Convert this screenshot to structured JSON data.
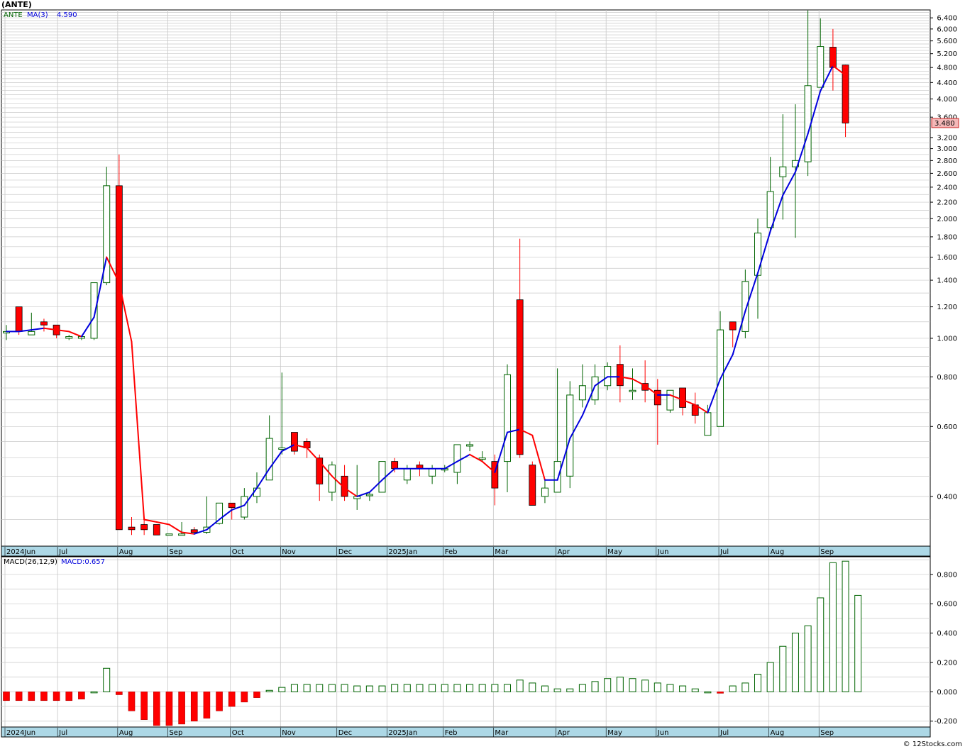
{
  "header": {
    "symbol_title": "(ANTE)"
  },
  "legend": {
    "ticker": "ANTE",
    "ma_label": "MA(3)",
    "ma_value": "4.590",
    "macd_label": "MACD(26,12,9)",
    "macd_value": "MACD:0.657"
  },
  "watermark": "© 12Stocks.com",
  "colors": {
    "up": "#006400",
    "down": "#ff0000",
    "ma_rising": "#0000dd",
    "ma_falling": "#ff0000",
    "axis_band": "#add8e6",
    "grid": "#c8c8c8",
    "last_price_box": "#f4b8b8"
  },
  "chart_data": [
    {
      "type": "candlestick",
      "scale": "log",
      "ylim": [
        0.3,
        6.7
      ],
      "yticks": [
        "6.400",
        "6.000",
        "5.600",
        "5.200",
        "4.800",
        "4.400",
        "4.000",
        "3.600",
        "3.200",
        "3.000",
        "2.800",
        "2.600",
        "2.400",
        "2.200",
        "2.000",
        "1.800",
        "1.600",
        "1.400",
        "1.200",
        "1.000",
        "0.800",
        "0.600",
        "0.400"
      ],
      "last_price": "3.480",
      "x_months": [
        "2024Jun",
        "Jul",
        "Aug",
        "Sep",
        "Oct",
        "Nov",
        "Dec",
        "2025Jan",
        "Feb",
        "Mar",
        "Apr",
        "May",
        "Jun",
        "Jul",
        "Aug",
        "Sep"
      ],
      "bars": [
        {
          "o": 1.04,
          "h": 1.08,
          "l": 0.99,
          "c": 1.04
        },
        {
          "o": 1.2,
          "h": 1.2,
          "l": 1.02,
          "c": 1.04
        },
        {
          "o": 1.02,
          "h": 1.16,
          "l": 1.02,
          "c": 1.04
        },
        {
          "o": 1.1,
          "h": 1.12,
          "l": 1.04,
          "c": 1.08
        },
        {
          "o": 1.08,
          "h": 1.08,
          "l": 1.0,
          "c": 1.02
        },
        {
          "o": 1.0,
          "h": 1.02,
          "l": 0.99,
          "c": 1.01
        },
        {
          "o": 1.0,
          "h": 1.01,
          "l": 0.99,
          "c": 1.01
        },
        {
          "o": 1.0,
          "h": 1.38,
          "l": 0.99,
          "c": 1.38
        },
        {
          "o": 1.38,
          "h": 2.7,
          "l": 1.36,
          "c": 2.42
        },
        {
          "o": 2.42,
          "h": 2.9,
          "l": 0.33,
          "c": 0.33
        },
        {
          "o": 0.335,
          "h": 0.355,
          "l": 0.32,
          "c": 0.33
        },
        {
          "o": 0.34,
          "h": 0.355,
          "l": 0.32,
          "c": 0.33
        },
        {
          "o": 0.34,
          "h": 0.34,
          "l": 0.32,
          "c": 0.32
        },
        {
          "o": 0.322,
          "h": 0.322,
          "l": 0.32,
          "c": 0.322
        },
        {
          "o": 0.321,
          "h": 0.345,
          "l": 0.32,
          "c": 0.322
        },
        {
          "o": 0.33,
          "h": 0.335,
          "l": 0.322,
          "c": 0.325
        },
        {
          "o": 0.325,
          "h": 0.4,
          "l": 0.322,
          "c": 0.335
        },
        {
          "o": 0.342,
          "h": 0.385,
          "l": 0.34,
          "c": 0.385
        },
        {
          "o": 0.385,
          "h": 0.385,
          "l": 0.35,
          "c": 0.375
        },
        {
          "o": 0.355,
          "h": 0.42,
          "l": 0.35,
          "c": 0.4
        },
        {
          "o": 0.4,
          "h": 0.46,
          "l": 0.385,
          "c": 0.42
        },
        {
          "o": 0.44,
          "h": 0.64,
          "l": 0.44,
          "c": 0.56
        },
        {
          "o": 0.53,
          "h": 0.82,
          "l": 0.51,
          "c": 0.53
        },
        {
          "o": 0.58,
          "h": 0.58,
          "l": 0.51,
          "c": 0.52
        },
        {
          "o": 0.55,
          "h": 0.56,
          "l": 0.5,
          "c": 0.53
        },
        {
          "o": 0.5,
          "h": 0.51,
          "l": 0.39,
          "c": 0.43
        },
        {
          "o": 0.41,
          "h": 0.49,
          "l": 0.39,
          "c": 0.48
        },
        {
          "o": 0.45,
          "h": 0.48,
          "l": 0.39,
          "c": 0.4
        },
        {
          "o": 0.395,
          "h": 0.48,
          "l": 0.37,
          "c": 0.4
        },
        {
          "o": 0.405,
          "h": 0.41,
          "l": 0.39,
          "c": 0.405
        },
        {
          "o": 0.41,
          "h": 0.49,
          "l": 0.41,
          "c": 0.49
        },
        {
          "o": 0.49,
          "h": 0.5,
          "l": 0.46,
          "c": 0.47
        },
        {
          "o": 0.44,
          "h": 0.48,
          "l": 0.43,
          "c": 0.47
        },
        {
          "o": 0.48,
          "h": 0.49,
          "l": 0.45,
          "c": 0.47
        },
        {
          "o": 0.45,
          "h": 0.48,
          "l": 0.43,
          "c": 0.47
        },
        {
          "o": 0.47,
          "h": 0.48,
          "l": 0.46,
          "c": 0.47
        },
        {
          "o": 0.46,
          "h": 0.54,
          "l": 0.43,
          "c": 0.54
        },
        {
          "o": 0.54,
          "h": 0.55,
          "l": 0.52,
          "c": 0.54
        },
        {
          "o": 0.5,
          "h": 0.52,
          "l": 0.49,
          "c": 0.5
        },
        {
          "o": 0.49,
          "h": 0.51,
          "l": 0.38,
          "c": 0.42
        },
        {
          "o": 0.49,
          "h": 0.86,
          "l": 0.41,
          "c": 0.81
        },
        {
          "o": 1.25,
          "h": 1.78,
          "l": 0.5,
          "c": 0.51
        },
        {
          "o": 0.48,
          "h": 0.49,
          "l": 0.38,
          "c": 0.38
        },
        {
          "o": 0.4,
          "h": 0.44,
          "l": 0.385,
          "c": 0.42
        },
        {
          "o": 0.41,
          "h": 0.84,
          "l": 0.41,
          "c": 0.49
        },
        {
          "o": 0.45,
          "h": 0.78,
          "l": 0.42,
          "c": 0.72
        },
        {
          "o": 0.7,
          "h": 0.86,
          "l": 0.67,
          "c": 0.76
        },
        {
          "o": 0.7,
          "h": 0.86,
          "l": 0.68,
          "c": 0.8
        },
        {
          "o": 0.76,
          "h": 0.87,
          "l": 0.74,
          "c": 0.85
        },
        {
          "o": 0.86,
          "h": 0.96,
          "l": 0.69,
          "c": 0.76
        },
        {
          "o": 0.74,
          "h": 0.84,
          "l": 0.7,
          "c": 0.74
        },
        {
          "o": 0.77,
          "h": 0.88,
          "l": 0.69,
          "c": 0.74
        },
        {
          "o": 0.74,
          "h": 0.79,
          "l": 0.54,
          "c": 0.68
        },
        {
          "o": 0.66,
          "h": 0.74,
          "l": 0.65,
          "c": 0.74
        },
        {
          "o": 0.75,
          "h": 0.75,
          "l": 0.64,
          "c": 0.67
        },
        {
          "o": 0.68,
          "h": 0.73,
          "l": 0.61,
          "c": 0.64
        },
        {
          "o": 0.57,
          "h": 0.68,
          "l": 0.57,
          "c": 0.65
        },
        {
          "o": 0.6,
          "h": 1.17,
          "l": 0.6,
          "c": 1.05
        },
        {
          "o": 1.1,
          "h": 1.1,
          "l": 0.95,
          "c": 1.05
        },
        {
          "o": 1.04,
          "h": 1.49,
          "l": 1.0,
          "c": 1.39
        },
        {
          "o": 1.44,
          "h": 2.0,
          "l": 1.12,
          "c": 1.84
        },
        {
          "o": 1.9,
          "h": 2.86,
          "l": 1.85,
          "c": 2.34
        },
        {
          "o": 2.55,
          "h": 3.66,
          "l": 1.99,
          "c": 2.7
        },
        {
          "o": 2.7,
          "h": 3.88,
          "l": 1.79,
          "c": 2.8
        },
        {
          "o": 2.78,
          "h": 6.68,
          "l": 2.56,
          "c": 4.32
        },
        {
          "o": 4.28,
          "h": 6.38,
          "l": 4.28,
          "c": 5.42
        },
        {
          "o": 5.4,
          "h": 6.0,
          "l": 4.2,
          "c": 4.8
        },
        {
          "o": 4.87,
          "h": 4.88,
          "l": 3.21,
          "c": 3.48
        }
      ],
      "ma": [
        1.04,
        1.04,
        1.05,
        1.06,
        1.05,
        1.04,
        1.01,
        1.13,
        1.6,
        1.38,
        0.98,
        0.35,
        0.345,
        0.34,
        0.325,
        0.322,
        0.33,
        0.35,
        0.37,
        0.38,
        0.42,
        0.47,
        0.52,
        0.54,
        0.53,
        0.49,
        0.45,
        0.42,
        0.4,
        0.41,
        0.44,
        0.47,
        0.47,
        0.47,
        0.47,
        0.47,
        0.49,
        0.51,
        0.49,
        0.46,
        0.58,
        0.59,
        0.57,
        0.44,
        0.44,
        0.56,
        0.64,
        0.76,
        0.8,
        0.8,
        0.79,
        0.76,
        0.72,
        0.72,
        0.7,
        0.68,
        0.65,
        0.79,
        0.91,
        1.17,
        1.46,
        1.86,
        2.29,
        2.62,
        3.27,
        4.19,
        4.85,
        4.59
      ]
    },
    {
      "type": "bar",
      "title": "MACD(26,12,9)",
      "ylim": [
        -0.24,
        0.92
      ],
      "yticks": [
        "0.800",
        "0.600",
        "0.400",
        "0.200",
        "0.000",
        "-0.200"
      ],
      "x_months": [
        "2024Jun",
        "Jul",
        "Aug",
        "Sep",
        "Oct",
        "Nov",
        "Dec",
        "2025Jan",
        "Feb",
        "Mar",
        "Apr",
        "May",
        "Jun",
        "Jul",
        "Aug",
        "Sep"
      ],
      "values": [
        -0.06,
        -0.06,
        -0.06,
        -0.06,
        -0.06,
        -0.06,
        -0.05,
        0.0,
        0.16,
        -0.02,
        -0.13,
        -0.19,
        -0.23,
        -0.23,
        -0.22,
        -0.2,
        -0.18,
        -0.13,
        -0.1,
        -0.07,
        -0.04,
        0.01,
        0.03,
        0.05,
        0.05,
        0.05,
        0.05,
        0.05,
        0.04,
        0.04,
        0.04,
        0.05,
        0.05,
        0.05,
        0.05,
        0.05,
        0.05,
        0.05,
        0.05,
        0.05,
        0.05,
        0.08,
        0.06,
        0.04,
        0.02,
        0.02,
        0.05,
        0.07,
        0.09,
        0.1,
        0.09,
        0.08,
        0.06,
        0.05,
        0.04,
        0.02,
        0.0,
        -0.01,
        0.04,
        0.06,
        0.12,
        0.2,
        0.31,
        0.4,
        0.45,
        0.64,
        0.88,
        0.89,
        0.657
      ]
    }
  ]
}
